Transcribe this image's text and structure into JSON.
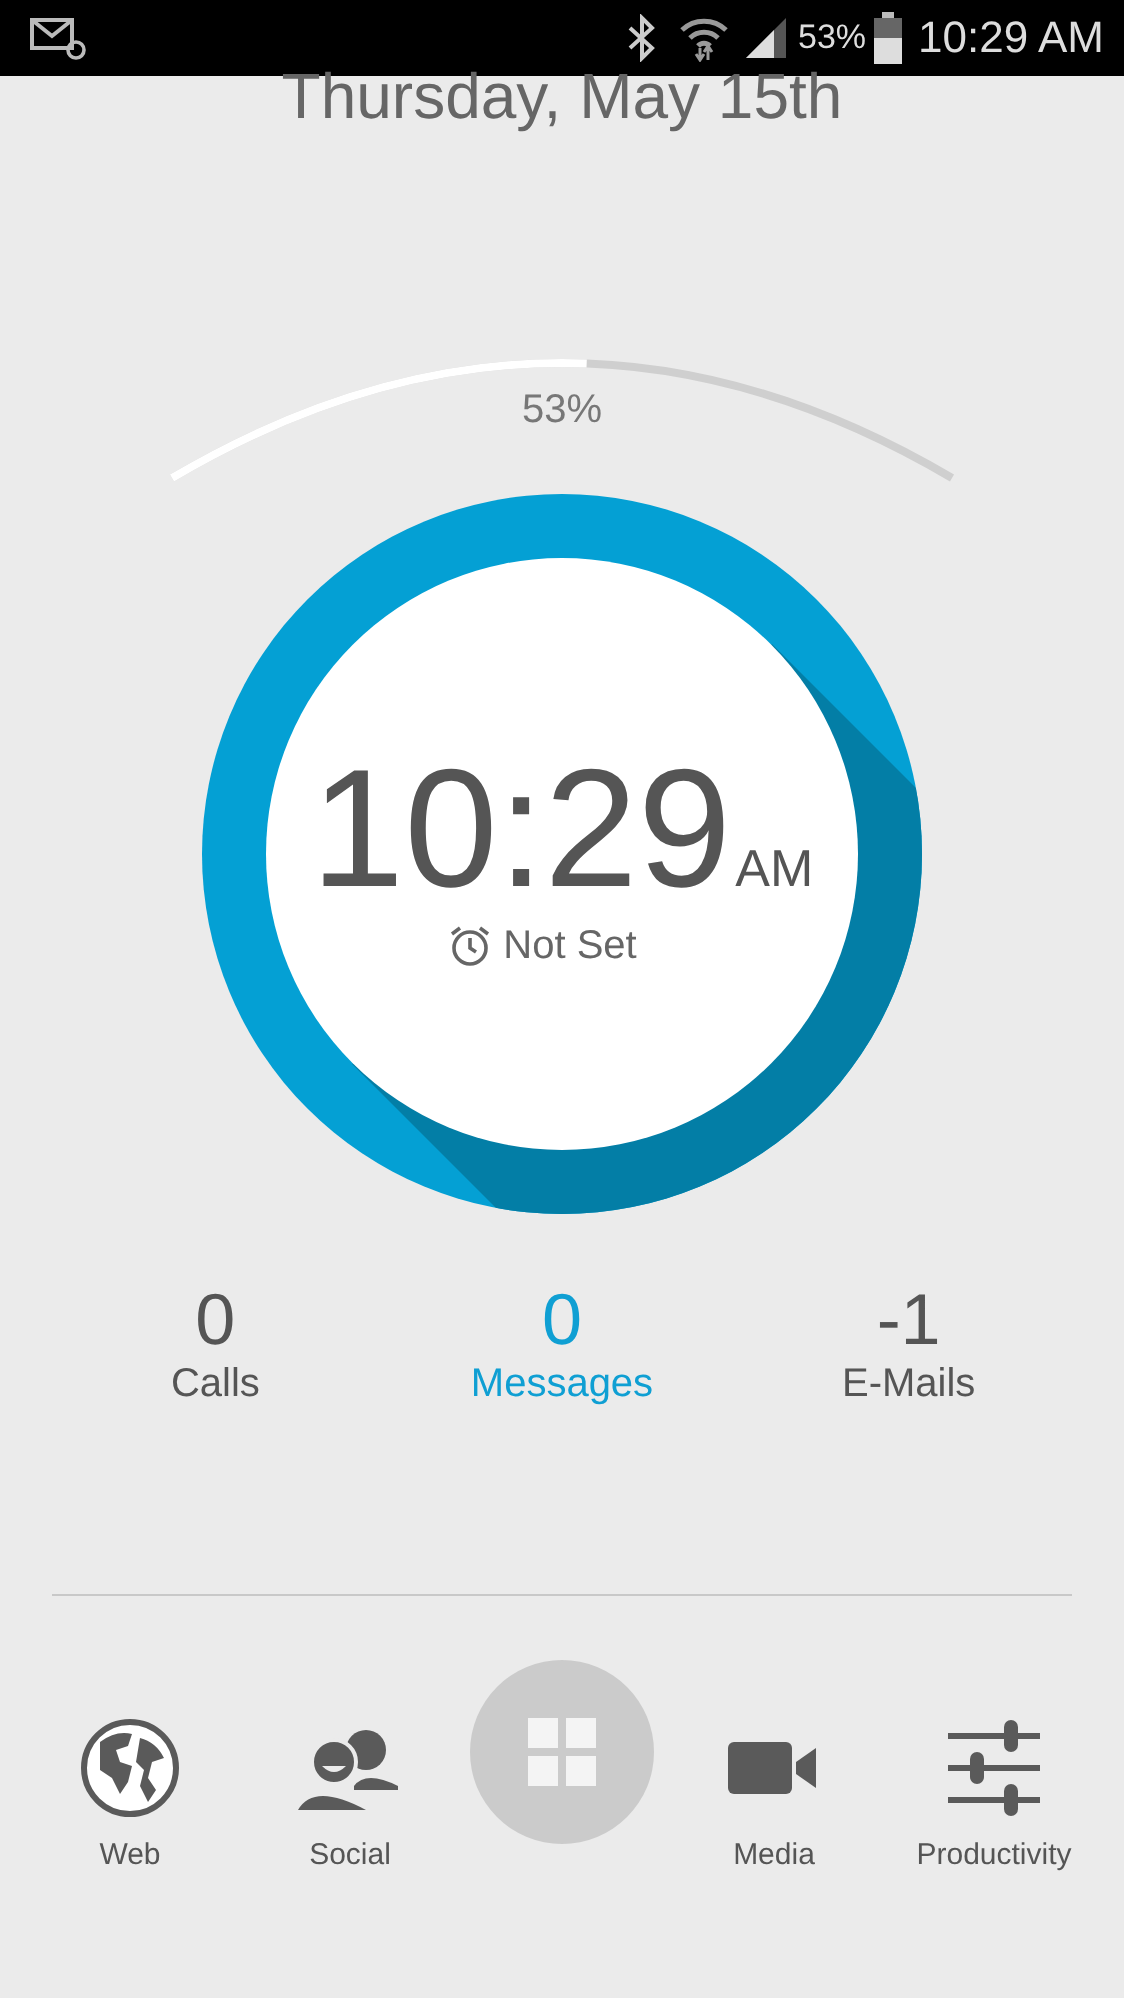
{
  "status_bar": {
    "battery_text": "53%",
    "time": "10:29 AM"
  },
  "date": "Thursday, May 15th",
  "battery": {
    "reading": "53%"
  },
  "clock": {
    "time": "10:29",
    "period": "AM",
    "alarm": "Not Set"
  },
  "stats": [
    {
      "count": "0",
      "label": "Calls",
      "selected": false
    },
    {
      "count": "0",
      "label": "Messages",
      "selected": true
    },
    {
      "count": "-1",
      "label": "E-Mails",
      "selected": false
    }
  ],
  "dock": [
    {
      "kind": "web",
      "label": "Web"
    },
    {
      "kind": "social",
      "label": "Social"
    },
    {
      "kind": "apps"
    },
    {
      "kind": "media",
      "label": "Media"
    },
    {
      "kind": "productivity",
      "label": "Productivity"
    }
  ]
}
